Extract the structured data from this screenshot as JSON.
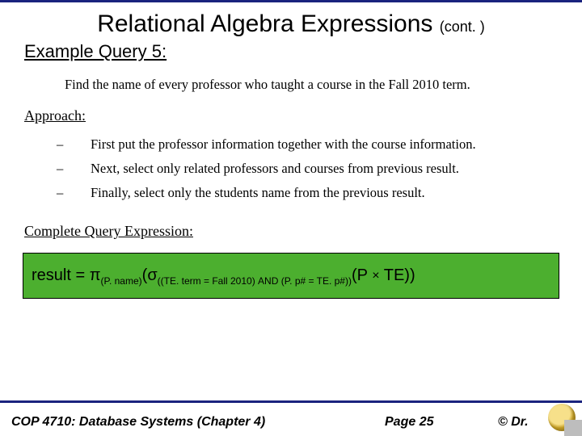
{
  "title": {
    "main": "Relational Algebra Expressions",
    "cont": "(cont. )"
  },
  "subtitle": "Example Query 5:",
  "prompt": "Find the name of every professor who taught a course in the Fall 2010 term.",
  "approach": {
    "label": "Approach:",
    "items": [
      "First put the professor information together with the course information.",
      " Next,  select only related professors and courses from previous result.",
      "Finally, select only the students name from the previous result."
    ]
  },
  "complete_label": "Complete Query Expression:",
  "expression": {
    "lhs": "result = ",
    "pi": "π",
    "pi_sub": "(P. name)",
    "open1": "(",
    "sigma": "σ",
    "sigma_sub": "((TE. term = Fall 2010)  AND  (P. p# = TE. p#))",
    "open2": "(P ",
    "times": "×",
    "open3": " TE))"
  },
  "footer": {
    "course": "COP 4710: Database Systems  (Chapter 4)",
    "page": "Page 25",
    "copyright": "© Dr."
  }
}
